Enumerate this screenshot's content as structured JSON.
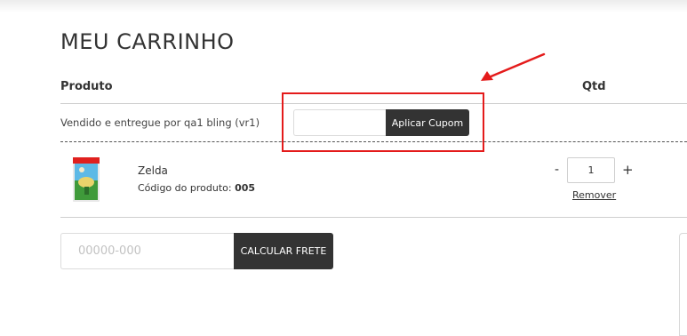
{
  "page": {
    "title": "MEU CARRINHO"
  },
  "table": {
    "header_product": "Produto",
    "header_qty": "Qtd"
  },
  "seller": {
    "text": "Vendido e entregue por qa1 bling (vr1)"
  },
  "coupon": {
    "input_value": "",
    "button_label": "Aplicar Cupom"
  },
  "cart_items": [
    {
      "name": "Zelda",
      "code_label": "Código do produto:",
      "code_value": "005",
      "quantity": "1",
      "minus_label": "-",
      "plus_label": "+",
      "remove_label": "Remover"
    }
  ],
  "shipping": {
    "cep_placeholder": "00000-000",
    "button_label": "CALCULAR FRETE"
  },
  "annotation": {
    "highlight_color": "#e41b1b"
  },
  "colors": {
    "button_bg": "#333333",
    "text": "#333333"
  }
}
